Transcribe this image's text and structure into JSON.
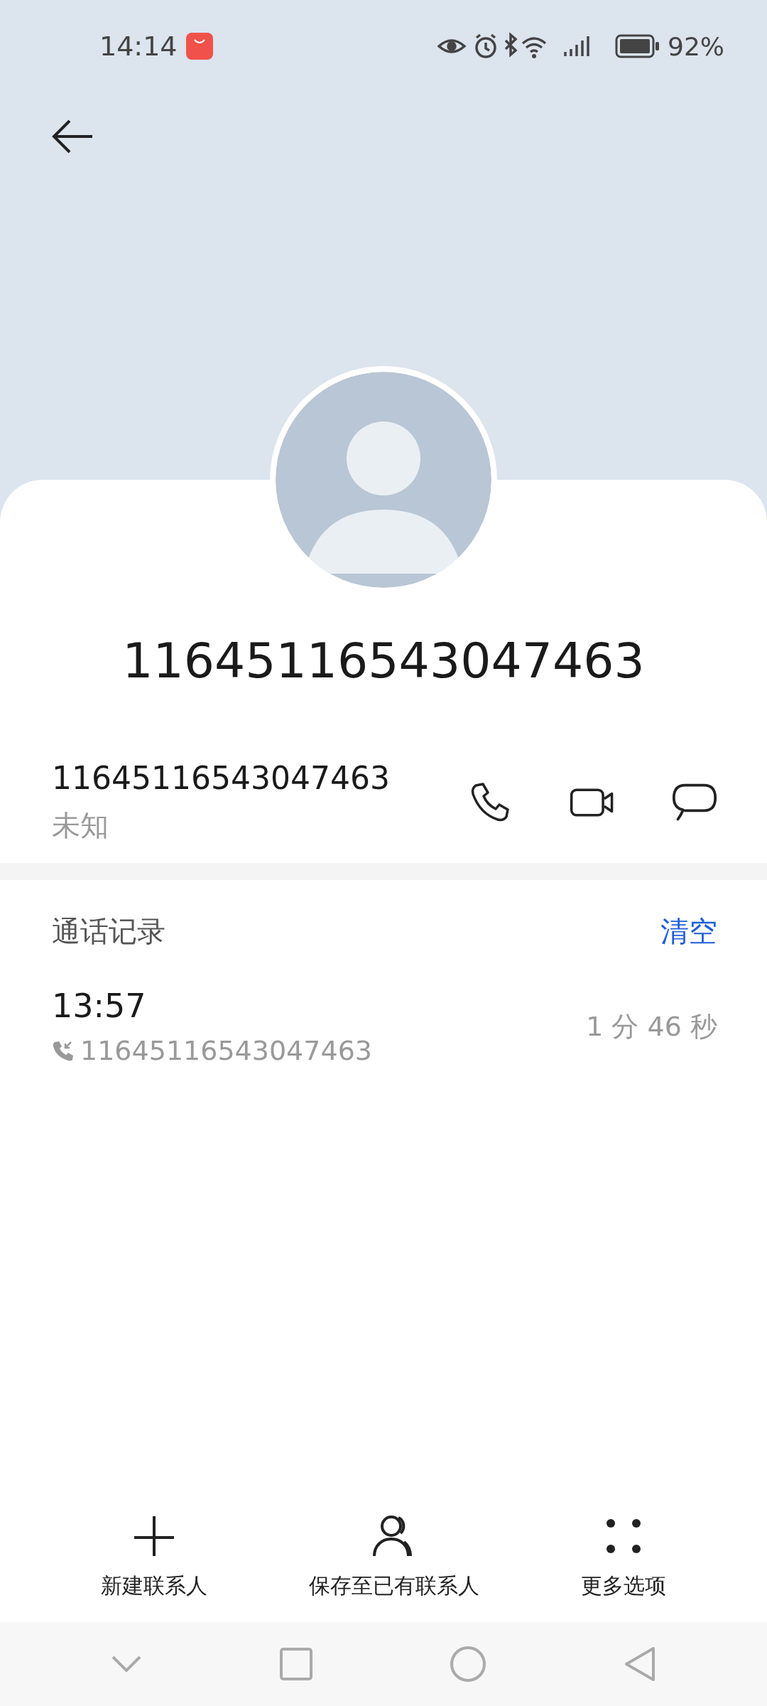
{
  "status_bar": {
    "time": "14:14",
    "battery": "92%"
  },
  "contact": {
    "title": "11645116543047463",
    "number": "11645116543047463",
    "label": "未知"
  },
  "call_log": {
    "title": "通话记录",
    "clear": "清空",
    "entries": [
      {
        "time": "13:57",
        "number": "11645116543047463",
        "duration": "1 分 46 秒"
      }
    ]
  },
  "actions": [
    {
      "kind": "add",
      "label": "新建联系人"
    },
    {
      "kind": "person",
      "label": "保存至已有联系人"
    },
    {
      "kind": "more",
      "label": "更多选项"
    }
  ]
}
